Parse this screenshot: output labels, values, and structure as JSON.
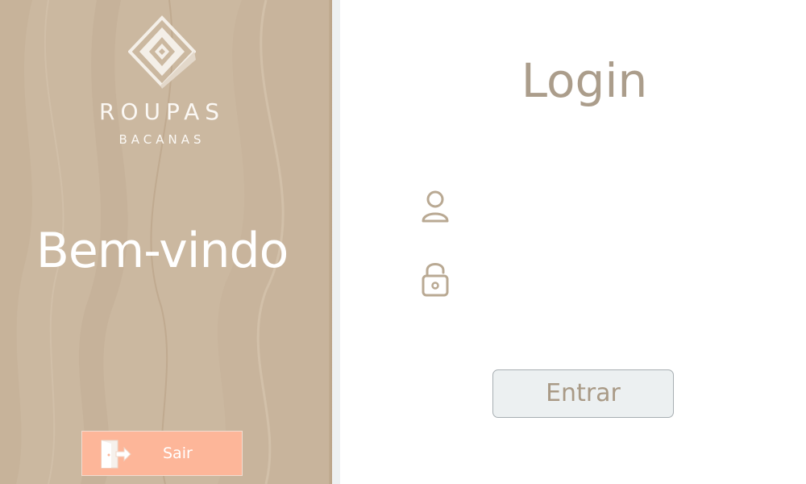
{
  "brand": {
    "name": "ROUPAS",
    "subtitle": "BACANAS",
    "icon": "diamond-logo-icon"
  },
  "welcome": {
    "text": "Bem-vindo"
  },
  "exit_button": {
    "label": "Sair",
    "icon": "exit-door-icon"
  },
  "login": {
    "title": "Login",
    "username": {
      "icon": "user-icon",
      "value": "",
      "placeholder": ""
    },
    "password": {
      "icon": "lock-icon",
      "value": "",
      "placeholder": ""
    },
    "submit_label": "Entrar"
  },
  "colors": {
    "left_panel": "#cbb8a0",
    "exit_button": "#fdb699",
    "accent_text": "#ab9d8b",
    "enter_button": "#ecf0f1"
  }
}
